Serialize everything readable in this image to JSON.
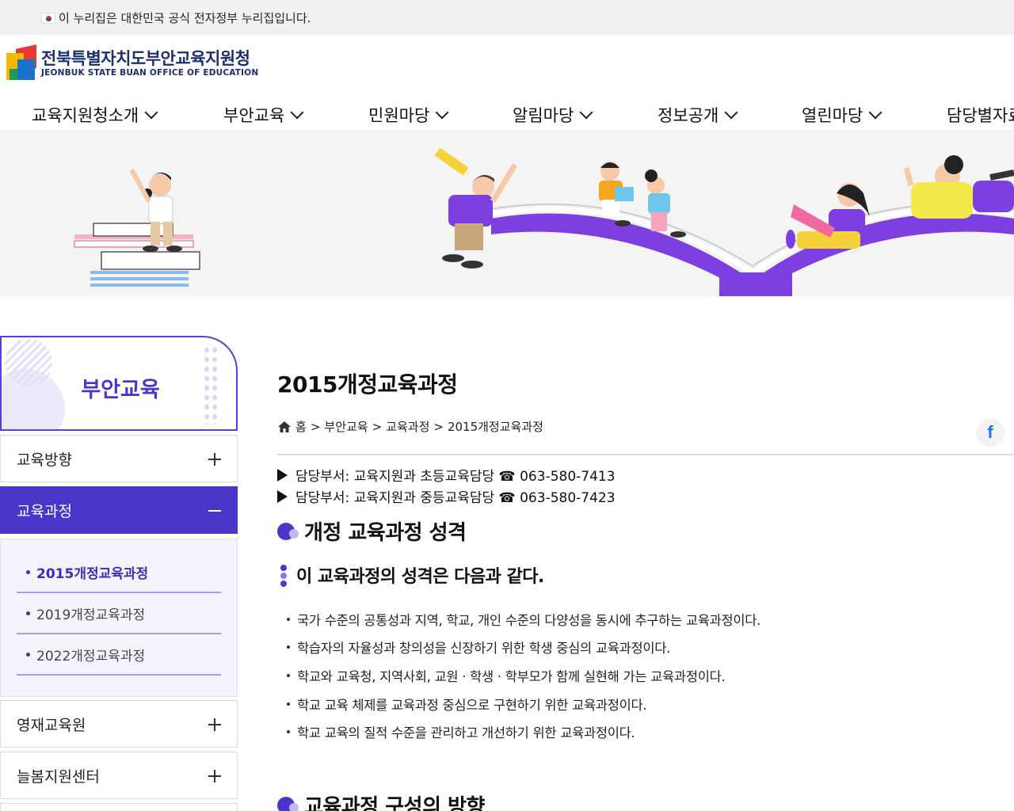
{
  "gov_banner": {
    "text": "이 누리집은 대한민국 공식 전자정부 누리집입니다."
  },
  "logo": {
    "ko": "전북특별자치도부안교육지원청",
    "en": "JEONBUK STATE BUAN OFFICE OF EDUCATION"
  },
  "gnb": [
    {
      "label": "교육지원청소개"
    },
    {
      "label": "부안교육"
    },
    {
      "label": "민원마당"
    },
    {
      "label": "알림마당"
    },
    {
      "label": "정보공개"
    },
    {
      "label": "열린마당"
    },
    {
      "label": "담당별자료"
    }
  ],
  "sidebar": {
    "title": "부안교육",
    "menus": [
      {
        "label": "교육방향"
      },
      {
        "label": "교육과정"
      },
      {
        "label": "영재교육원"
      },
      {
        "label": "늘봄지원센터"
      }
    ],
    "submenu": [
      {
        "label": "2015개정교육과정"
      },
      {
        "label": "2019개정교육과정"
      },
      {
        "label": "2022개정교육과정"
      }
    ]
  },
  "content": {
    "title": "2015개정교육과정",
    "breadcrumb": {
      "home": "홈",
      "sep": ">",
      "level1": "부안교육",
      "level2": "교육과정",
      "level3": "2015개정교육과정"
    },
    "share_icon": "facebook-icon",
    "departments": [
      "담당부서: 교육지원과 초등교육담당 ☎ 063-580-7413",
      "담당부서: 교육지원과 중등교육담당 ☎ 063-580-7423"
    ],
    "section1_title": "개정 교육과정 성격",
    "subsection_title": "이 교육과정의 성격은 다음과 같다.",
    "bullets": [
      "국가 수준의 공통성과 지역, 학교, 개인 수준의 다양성을 동시에 추구하는 교육과정이다.",
      "학습자의 자율성과 창의성을 신장하기 위한 학생 중심의 교육과정이다.",
      "학교와 교육청, 지역사회, 교원 · 학생 · 학부모가 함께 실현해 가는 교육과정이다.",
      "학교 교육 체제를 교육과정 중심으로 구현하기 위한 교육과정이다.",
      "학교 교육의 질적 수준을 관리하고 개선하기 위한 교육과정이다."
    ],
    "section2_title": "교육과정 구성의 방향"
  },
  "colors": {
    "accent": "#4a36c9",
    "accent_light": "#c3b8f5",
    "logo_navy": "#1a2f6e"
  }
}
